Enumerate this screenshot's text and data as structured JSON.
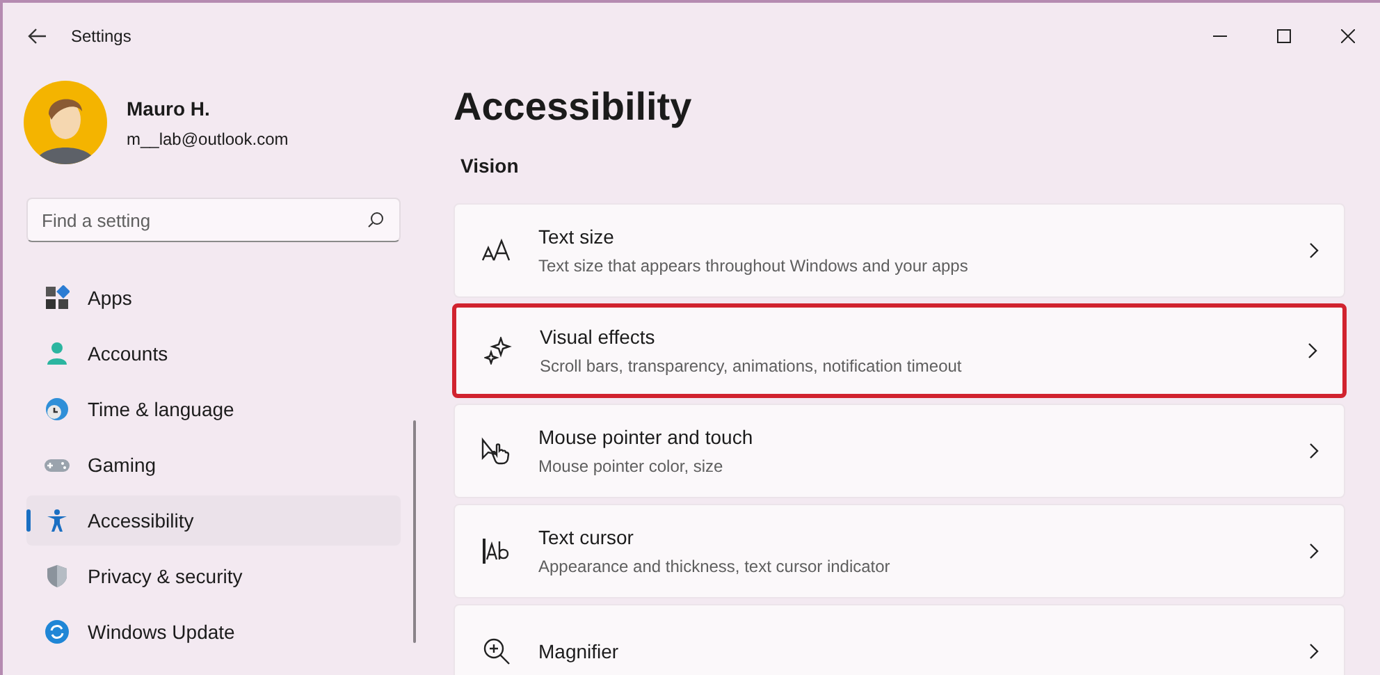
{
  "window": {
    "title": "Settings"
  },
  "user": {
    "name": "Mauro H.",
    "email": "m__lab@outlook.com"
  },
  "search": {
    "placeholder": "Find a setting"
  },
  "sidebar": {
    "items": [
      {
        "label": "Apps",
        "kind": "apps",
        "selected": false
      },
      {
        "label": "Accounts",
        "kind": "accounts",
        "selected": false
      },
      {
        "label": "Time & language",
        "kind": "time",
        "selected": false
      },
      {
        "label": "Gaming",
        "kind": "gaming",
        "selected": false
      },
      {
        "label": "Accessibility",
        "kind": "accessibility",
        "selected": true
      },
      {
        "label": "Privacy & security",
        "kind": "privacy",
        "selected": false
      },
      {
        "label": "Windows Update",
        "kind": "update",
        "selected": false
      }
    ]
  },
  "page": {
    "title": "Accessibility",
    "section": "Vision",
    "items": [
      {
        "title": "Text size",
        "description": "Text size that appears throughout Windows and your apps",
        "kind": "textsize",
        "highlighted": false
      },
      {
        "title": "Visual effects",
        "description": "Scroll bars, transparency, animations, notification timeout",
        "kind": "sparkle",
        "highlighted": true
      },
      {
        "title": "Mouse pointer and touch",
        "description": "Mouse pointer color, size",
        "kind": "pointer",
        "highlighted": false
      },
      {
        "title": "Text cursor",
        "description": "Appearance and thickness, text cursor indicator",
        "kind": "cursor",
        "highlighted": false
      },
      {
        "title": "Magnifier",
        "kind": "magnifier",
        "highlighted": false
      }
    ]
  }
}
